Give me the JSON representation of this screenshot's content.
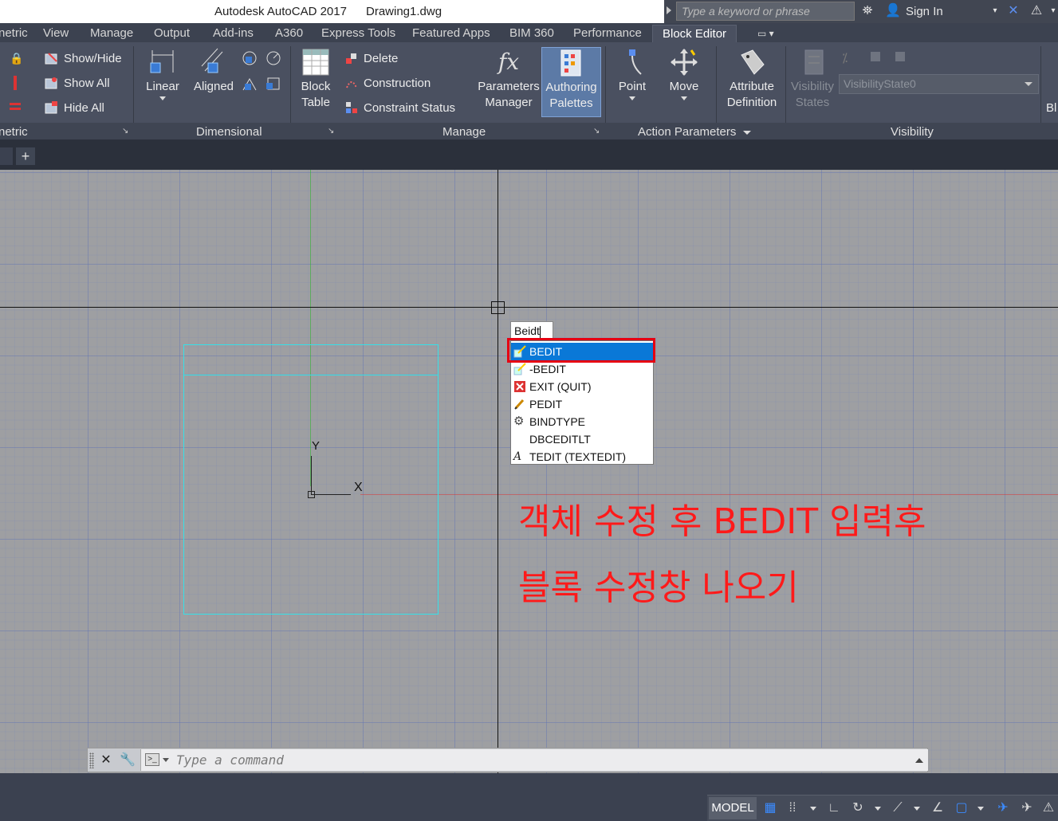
{
  "titlebar": {
    "app_title": "Autodesk AutoCAD 2017",
    "file_name": "Drawing1.dwg",
    "search_placeholder": "Type a keyword or phrase",
    "signin_label": "Sign In"
  },
  "tabs": [
    {
      "label": "netric"
    },
    {
      "label": "View"
    },
    {
      "label": "Manage"
    },
    {
      "label": "Output"
    },
    {
      "label": "Add-ins"
    },
    {
      "label": "A360"
    },
    {
      "label": "Express Tools"
    },
    {
      "label": "Featured Apps"
    },
    {
      "label": "BIM 360"
    },
    {
      "label": "Performance"
    },
    {
      "label": "Block Editor"
    }
  ],
  "ribbon": {
    "geometric": {
      "label": "netric",
      "show_hide": "Show/Hide",
      "show_all": "Show All",
      "hide_all": "Hide All"
    },
    "dimensional": {
      "label": "Dimensional",
      "linear": "Linear",
      "aligned": "Aligned"
    },
    "manage": {
      "label": "Manage",
      "block_table_1": "Block",
      "block_table_2": "Table",
      "delete": "Delete",
      "construction": "Construction",
      "constraint_status": "Constraint Status",
      "parameters_manager_1": "Parameters",
      "parameters_manager_2": "Manager",
      "authoring_palettes_1": "Authoring",
      "authoring_palettes_2": "Palettes"
    },
    "action_parameters": {
      "label": "Action Parameters",
      "point": "Point",
      "move": "Move",
      "attribute_definition_1": "Attribute",
      "attribute_definition_2": "Definition"
    },
    "visibility": {
      "label": "Visibility",
      "visibility_states_1": "Visibility",
      "visibility_states_2": "States",
      "state_value": "VisibilityState0"
    },
    "next_panel_label": "Bl"
  },
  "canvas": {
    "ucs_y": "Y",
    "ucs_x": "X",
    "dynamic_input_value": "Beidt",
    "autocomplete": [
      {
        "label": "BEDIT",
        "icon": "bedit-icon",
        "selected": true
      },
      {
        "label": "-BEDIT",
        "icon": "bedit-icon",
        "selected": false
      },
      {
        "label": "EXIT (QUIT)",
        "icon": "exit-icon",
        "selected": false
      },
      {
        "label": "PEDIT",
        "icon": "pedit-icon",
        "selected": false
      },
      {
        "label": "BINDTYPE",
        "icon": "gear-icon",
        "selected": false
      },
      {
        "label": "DBCEDITLT",
        "icon": "",
        "selected": false
      },
      {
        "label": "TEDIT (TEXTEDIT)",
        "icon": "text-edit-icon",
        "selected": false
      }
    ],
    "annotation_line1": "객체 수정 후 BEDIT 입력후",
    "annotation_line2": "블록 수정창 나오기",
    "annotation_color": "#ff1a1a",
    "highlight_color": "#e60012"
  },
  "command_line": {
    "placeholder": "Type a command"
  },
  "statusbar": {
    "model_label": "MODEL"
  },
  "colors": {
    "ribbon_bg": "#4a5060",
    "canvas_bg": "#9e9fa2",
    "selection_blue": "#0a78d7",
    "block_outline": "#35e0e8"
  }
}
